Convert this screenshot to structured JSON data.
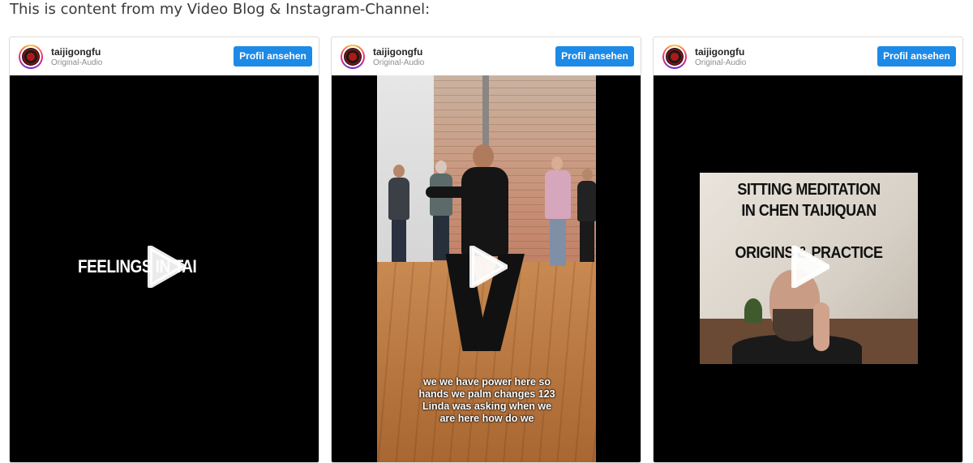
{
  "intro_text": "This is content from my Video Blog & Instagram-Channel:",
  "embeds": [
    {
      "username": "taijigongfu",
      "audio": "Original-Audio",
      "button_label": "Profil ansehen",
      "video_text": "FEELINGS IN TAI"
    },
    {
      "username": "taijigongfu",
      "audio": "Original-Audio",
      "button_label": "Profil ansehen",
      "caption_lines": [
        "we we have power here so",
        "hands we palm changes 123",
        "Linda was asking when we",
        "are here how do we"
      ]
    },
    {
      "username": "taijigongfu",
      "audio": "Original-Audio",
      "button_label": "Profil ansehen",
      "title_lines": [
        "SITTING MEDITATION",
        "IN CHEN TAIJIQUAN",
        "ORIGINS & PRACTICE"
      ]
    }
  ],
  "colors": {
    "button": "#1c8ae6",
    "video_bg": "#000000"
  },
  "icons": {
    "play": "play-icon",
    "avatar": "taijigongfu-logo"
  }
}
